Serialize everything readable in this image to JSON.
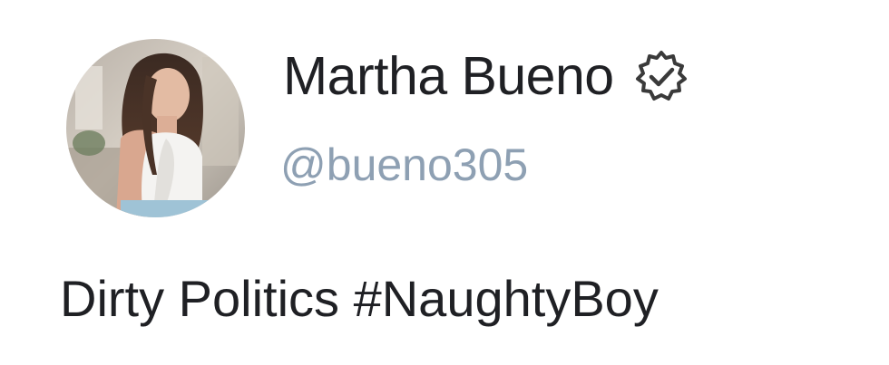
{
  "author": {
    "display_name": "Martha Bueno",
    "handle": "@bueno305",
    "verified_icon": "verified-badge-icon",
    "avatar_icon": "profile-photo"
  },
  "post": {
    "text": "Dirty Politics ",
    "hashtag": "#NaughtyBoy"
  },
  "colors": {
    "name": "#1f2024",
    "handle": "#8ea0b3",
    "badge": "#3a3a3a"
  }
}
